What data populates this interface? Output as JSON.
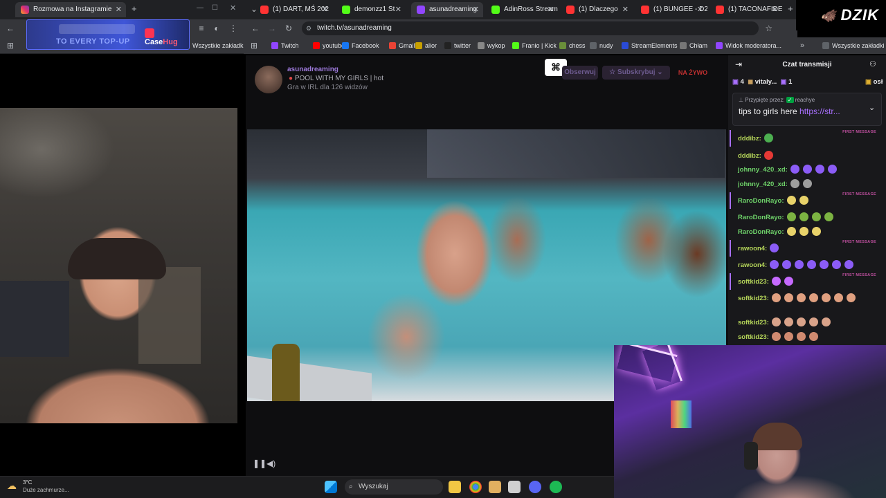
{
  "left_browser": {
    "tab_title": "Rozmowa na Instagramie",
    "bookmarks_label": "Wszystkie zakładki",
    "ad": {
      "top_text": "TO EVERY TOP-UP",
      "brand_a": "Case",
      "brand_b": "Hug"
    }
  },
  "right_browser": {
    "tabs": [
      {
        "title": "(1) DART, MŚ 202",
        "color": "#ff3333"
      },
      {
        "title": "demonzz1 St",
        "color": "#53fc18"
      },
      {
        "title": "asunadreaming",
        "color": "#9146ff"
      },
      {
        "title": "AdinRoss Stream",
        "color": "#53fc18"
      },
      {
        "title": "(1) Dlaczego",
        "color": "#ff3333"
      },
      {
        "title": "(1) BUNGEE - D2",
        "color": "#ff3333"
      },
      {
        "title": "(1) TACONAFIDE",
        "color": "#ff3333"
      }
    ],
    "url": "twitch.tv/asunadreaming",
    "bookmarks": [
      {
        "label": "Twitch",
        "color": "#9146ff"
      },
      {
        "label": "youtube",
        "color": "#ff0000"
      },
      {
        "label": "Facebook",
        "color": "#1877f2"
      },
      {
        "label": "Gmail",
        "color": "#ea4335"
      },
      {
        "label": "alior",
        "color": "#c8a000"
      },
      {
        "label": "twitter",
        "color": "#222222"
      },
      {
        "label": "wykop",
        "color": "#888888"
      },
      {
        "label": "Franio | Kick",
        "color": "#53fc18"
      },
      {
        "label": "chess",
        "color": "#6a8f3a"
      },
      {
        "label": "nudy",
        "color": "#5f6368"
      },
      {
        "label": "StreamElements",
        "color": "#2a4bd7"
      },
      {
        "label": "Chłam",
        "color": "#777777"
      },
      {
        "label": "Widok moderatora...",
        "color": "#9146ff"
      }
    ],
    "bookmarks_all": "Wszystkie zakładki"
  },
  "stream": {
    "channel": "asunadreaming",
    "title": "POOL WITH MY GIRLS | hot",
    "meta": "Gra w IRL dla 126 widzów",
    "follow": "Obserwuj",
    "subscribe": "Subskrybuj",
    "live": "NA ŻYWO"
  },
  "chat": {
    "header": "Czat transmisji",
    "top_bar": {
      "count": "4",
      "user": "vitaly...",
      "user_count": "1",
      "right": "osł"
    },
    "pinned_by": "Przypięte przez:",
    "pinned_user": "reachye",
    "pinned_text": "tips to girls here",
    "pinned_link": "https://str...",
    "first_message_label": "FIRST MESSAGE",
    "messages": [
      {
        "user": "dddibz:",
        "color": "#b6d65a",
        "emotes": [
          "#4caf50"
        ],
        "first": true
      },
      {
        "user": "dddibz:",
        "color": "#b6d65a",
        "emotes": [
          "#e53935"
        ],
        "first": false
      },
      {
        "user": "johnny_420_xd:",
        "color": "#6fd36a",
        "emotes": [
          "#8b5cf6",
          "#8b5cf6",
          "#8b5cf6",
          "#8b5cf6"
        ],
        "first": false
      },
      {
        "user": "johnny_420_xd:",
        "color": "#6fd36a",
        "emotes": [
          "#9e9e9e",
          "#9e9e9e"
        ],
        "first": false
      },
      {
        "user": "RaroDonRayo:",
        "color": "#6fd36a",
        "emotes": [
          "#e8d26a",
          "#e8d26a"
        ],
        "first": true
      },
      {
        "user": "RaroDonRayo:",
        "color": "#6fd36a",
        "emotes": [
          "#7cb342",
          "#7cb342",
          "#7cb342",
          "#7cb342"
        ],
        "first": false
      },
      {
        "user": "RaroDonRayo:",
        "color": "#6fd36a",
        "emotes": [
          "#e8d26a",
          "#e8d26a",
          "#e8d26a"
        ],
        "first": false
      },
      {
        "user": "rawoon4:",
        "color": "#b6d65a",
        "emotes": [
          "#8b5cf6"
        ],
        "first": true
      },
      {
        "user": "rawoon4:",
        "color": "#b6d65a",
        "emotes": [
          "#8b5cf6",
          "#8b5cf6",
          "#8b5cf6",
          "#8b5cf6",
          "#8b5cf6",
          "#8b5cf6",
          "#8b5cf6"
        ],
        "first": false
      },
      {
        "user": "softkid23:",
        "color": "#b6d65a",
        "emotes": [
          "#c569ff",
          "#c569ff"
        ],
        "first": true
      },
      {
        "user": "softkid23:",
        "color": "#b6d65a",
        "emotes": [
          "#e0a080",
          "#e0a080",
          "#e0a080",
          "#e0a080",
          "#e0a080",
          "#e0a080",
          "#e0a080"
        ],
        "first": false
      },
      {
        "user": "softkid23:",
        "color": "#b6d65a",
        "emotes": [
          "#d9a38a",
          "#d9a38a",
          "#d9a38a",
          "#d9a38a",
          "#d9a38a"
        ],
        "first": false
      },
      {
        "user": "softkid23:",
        "color": "#b6d65a",
        "emotes": [
          "#d08a70",
          "#d08a70",
          "#d08a70",
          "#d08a70"
        ],
        "first": false
      }
    ]
  },
  "taskbar": {
    "weather_temp": "3°C",
    "weather_desc": "Duże zachmurze...",
    "search_placeholder": "Wyszukaj"
  },
  "overlay_logo": "DZIK"
}
